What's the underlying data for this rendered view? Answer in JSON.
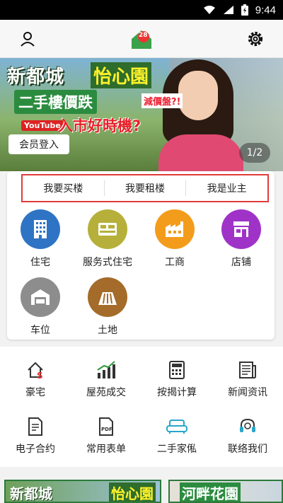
{
  "status": {
    "time": "9:44"
  },
  "header": {
    "logo_text": "28"
  },
  "banner": {
    "title_left": "新都城",
    "title_right": "怡心園",
    "subtitle": "二手樓價跌",
    "tag": "減價盤?!",
    "tagline": "入市好時機?",
    "youtube": "YouTube",
    "login": "会员登入",
    "pager": "1/2"
  },
  "tabs": [
    "我要买楼",
    "我要租楼",
    "我是业主"
  ],
  "categories": [
    {
      "label": "住宅",
      "icon": "building-icon",
      "color": "#2f74c4"
    },
    {
      "label": "服务式住宅",
      "icon": "bed-icon",
      "color": "#b6b03a"
    },
    {
      "label": "工商",
      "icon": "factory-icon",
      "color": "#f39c1b"
    },
    {
      "label": "店铺",
      "icon": "shop-icon",
      "color": "#a033c7"
    },
    {
      "label": "车位",
      "icon": "garage-icon",
      "color": "#8d8d8d"
    },
    {
      "label": "土地",
      "icon": "land-icon",
      "color": "#a46b2a"
    }
  ],
  "services": [
    {
      "label": "豪宅",
      "icon": "luxury-home-icon"
    },
    {
      "label": "屋苑成交",
      "icon": "bar-chart-icon"
    },
    {
      "label": "按揭计算",
      "icon": "calculator-icon"
    },
    {
      "label": "新闻资讯",
      "icon": "newspaper-icon"
    },
    {
      "label": "电子合约",
      "icon": "document-icon"
    },
    {
      "label": "常用表单",
      "icon": "pdf-icon"
    },
    {
      "label": "二手家俬",
      "icon": "sofa-icon"
    },
    {
      "label": "联络我们",
      "icon": "headset-icon"
    }
  ],
  "promos": [
    {
      "left": "新都城",
      "right": "怡心園"
    },
    {
      "left": "河畔花園"
    }
  ]
}
